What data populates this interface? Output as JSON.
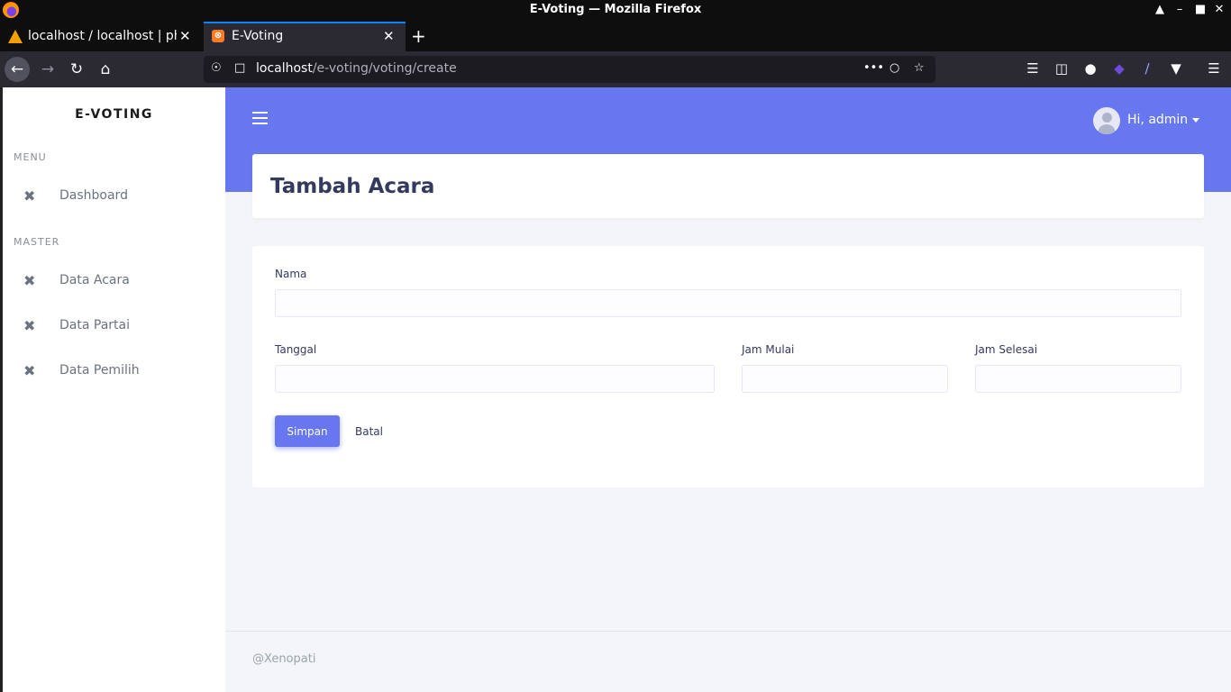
{
  "window": {
    "title": "E-Voting — Mozilla Firefox"
  },
  "tabs": [
    {
      "label": "localhost / localhost | phpMyAdmin",
      "active": false
    },
    {
      "label": "E-Voting",
      "active": true
    }
  ],
  "urlbar": {
    "host": "localhost",
    "path": "/e-voting/voting/create"
  },
  "sidebar": {
    "brand": "E-VOTING",
    "sections": [
      {
        "title": "MENU",
        "items": [
          {
            "label": "Dashboard",
            "icon": "tools-icon"
          }
        ]
      },
      {
        "title": "MASTER",
        "items": [
          {
            "label": "Data Acara",
            "icon": "tools-icon"
          },
          {
            "label": "Data Partai",
            "icon": "tools-icon"
          },
          {
            "label": "Data Pemilih",
            "icon": "tools-icon"
          }
        ]
      }
    ]
  },
  "header": {
    "user_greeting": "Hi, admin",
    "accent": "#6777ef"
  },
  "page": {
    "title": "Tambah Acara"
  },
  "form": {
    "nama_label": "Nama",
    "nama_value": "",
    "tanggal_label": "Tanggal",
    "tanggal_value": "",
    "jam_mulai_label": "Jam Mulai",
    "jam_mulai_value": "",
    "jam_selesai_label": "Jam Selesai",
    "jam_selesai_value": "",
    "save_label": "Simpan",
    "cancel_label": "Batal"
  },
  "footer": {
    "text": "@Xenopati"
  }
}
